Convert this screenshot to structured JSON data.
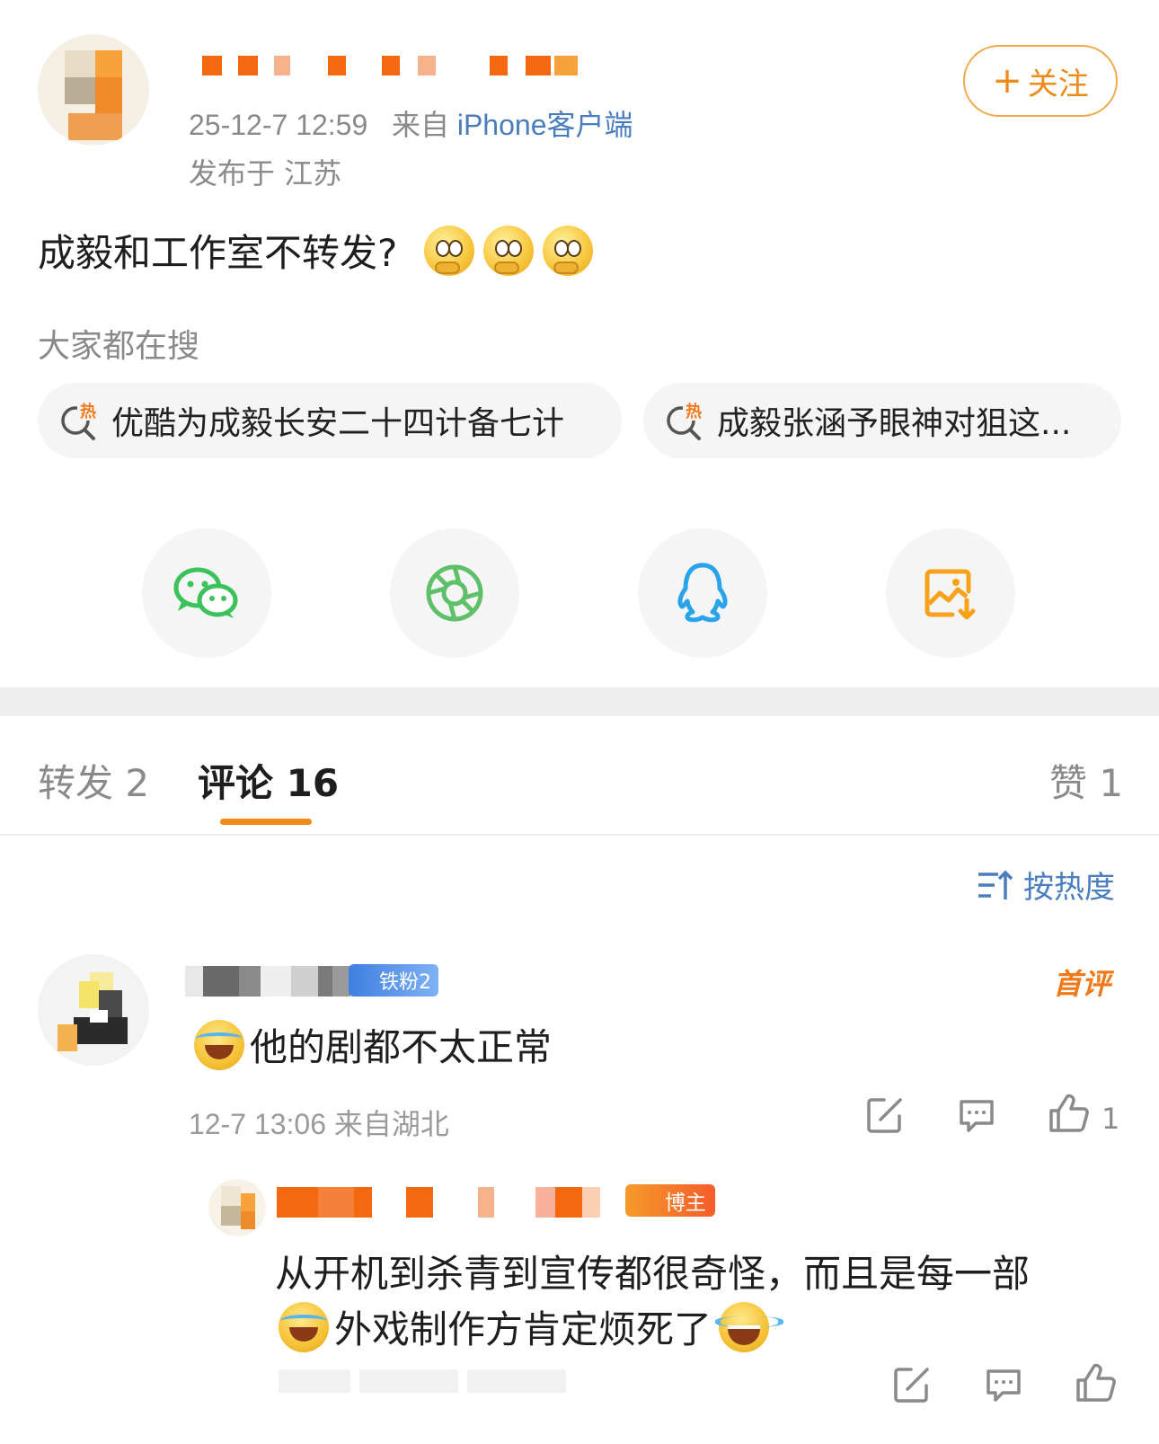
{
  "post": {
    "time": "25-12-7 12:59",
    "source_prefix": "来自",
    "source_name": "iPhone客户端",
    "location": "发布于 江苏",
    "follow_label": "关注",
    "follow_plus": "+",
    "text": "成毅和工作室不转发?"
  },
  "search": {
    "title": "大家都在搜",
    "items": [
      {
        "label": "优酷为成毅长安二十四计备七计",
        "badge": "热"
      },
      {
        "label": "成毅张涵予眼神对狙这...",
        "badge": "热"
      }
    ]
  },
  "share": {
    "icons": [
      "wechat-icon",
      "moments-icon",
      "qq-icon",
      "save-image-icon"
    ]
  },
  "tabs": [
    {
      "label": "转发 2"
    },
    {
      "label": "评论 16"
    },
    {
      "label": "赞 1"
    }
  ],
  "sort": {
    "label": "按热度"
  },
  "comment": {
    "fan_badge": "铁粉2",
    "first_badge": "首评",
    "text": "他的剧都不太正常",
    "meta": "12-7 13:06  来自湖北",
    "like_count": "1"
  },
  "reply": {
    "badge": "博主",
    "text_line1": "从开机到杀青到宣传都很奇怪，而且是每一部",
    "text_line2": "外戏制作方肯定烦死了"
  },
  "colors": {
    "accent": "#f08a1c",
    "link": "#4a7dbd",
    "muted": "#8a8a8a"
  }
}
